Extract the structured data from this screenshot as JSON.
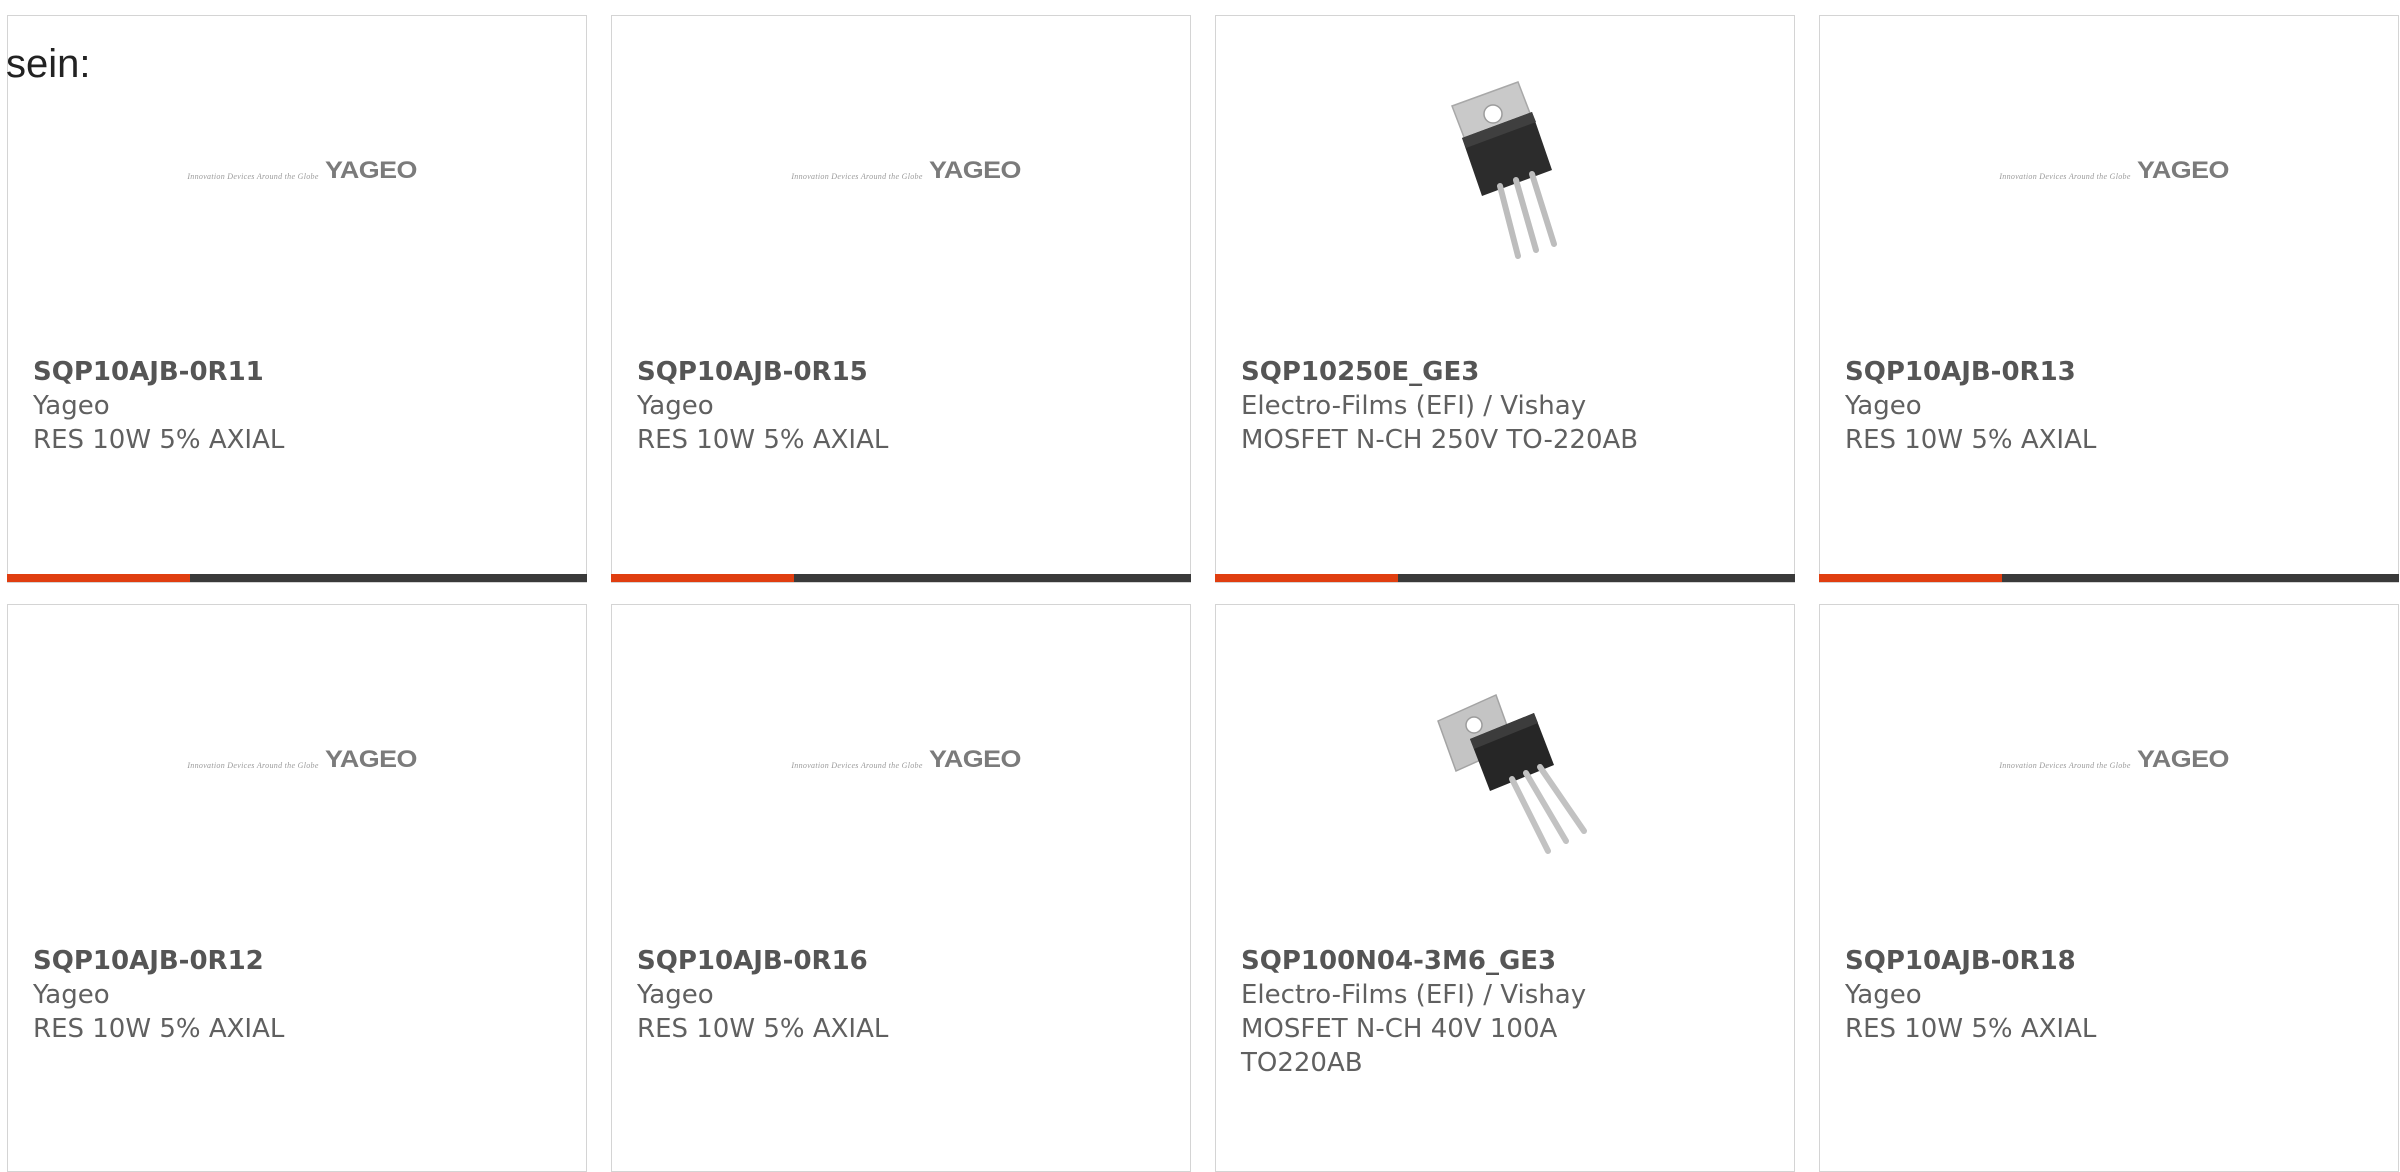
{
  "intro": "sein:",
  "logo": {
    "tagline": "Innovation Devices Around the Globe",
    "wordmark": "YAGEO"
  },
  "colors": {
    "accent": "#e03e10",
    "bar": "#3a3a3a",
    "border": "#d4d4d4",
    "text": "#606060"
  },
  "products": [
    {
      "part": "SQP10AJB-0R11",
      "maker": "Yageo",
      "desc": [
        "RES 10W 5% AXIAL"
      ],
      "image": "yageo-logo"
    },
    {
      "part": "SQP10AJB-0R15",
      "maker": "Yageo",
      "desc": [
        "RES 10W 5% AXIAL"
      ],
      "image": "yageo-logo"
    },
    {
      "part": "SQP10250E_GE3",
      "maker": "Electro-Films (EFI) / Vishay",
      "desc": [
        "MOSFET N-CH 250V TO-220AB"
      ],
      "image": "to220-transistor"
    },
    {
      "part": "SQP10AJB-0R13",
      "maker": "Yageo",
      "desc": [
        "RES 10W 5% AXIAL"
      ],
      "image": "yageo-logo"
    },
    {
      "part": "SQP10AJB-0R12",
      "maker": "Yageo",
      "desc": [
        "RES 10W 5% AXIAL"
      ],
      "image": "yageo-logo"
    },
    {
      "part": "SQP10AJB-0R16",
      "maker": "Yageo",
      "desc": [
        "RES 10W 5% AXIAL"
      ],
      "image": "yageo-logo"
    },
    {
      "part": "SQP100N04-3M6_GE3",
      "maker": "Electro-Films (EFI) / Vishay",
      "desc": [
        "MOSFET N-CH 40V 100A",
        "TO220AB"
      ],
      "image": "to220-transistor-angled"
    },
    {
      "part": "SQP10AJB-0R18",
      "maker": "Yageo",
      "desc": [
        "RES 10W 5% AXIAL"
      ],
      "image": "yageo-logo"
    }
  ]
}
